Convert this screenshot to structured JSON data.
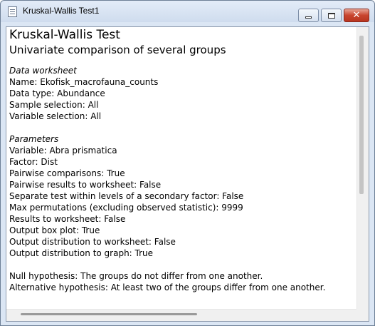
{
  "window": {
    "title": "Kruskal-Wallis Test1",
    "icon": "document-icon",
    "controls": {
      "minimize": "minimize-icon",
      "maximize": "maximize-icon",
      "close": "close-icon",
      "close_glyph": "✕"
    }
  },
  "report": {
    "title": "Kruskal-Wallis Test",
    "subtitle": "Univariate comparison of several groups",
    "data_section": {
      "heading": "Data worksheet",
      "lines": [
        "Name: Ekofisk_macrofauna_counts",
        "Data type: Abundance",
        "Sample selection: All",
        "Variable selection: All"
      ]
    },
    "parameters_section": {
      "heading": "Parameters",
      "lines": [
        "Variable: Abra prismatica",
        "Factor: Dist",
        "Pairwise comparisons: True",
        "Pairwise results to worksheet: False",
        "Separate test within levels of a secondary factor: False",
        "Max permutations (excluding observed statistic): 9999",
        "Results to worksheet: False",
        "Output box plot: True",
        "Output distribution to worksheet: False",
        "Output distribution to graph: True"
      ]
    },
    "hypotheses": [
      "Null hypothesis: The groups do not differ from one another.",
      "Alternative hypothesis: At least two of the groups differ from one another."
    ]
  },
  "colors": {
    "frame": "#dbe6f4",
    "close_button": "#c8452f",
    "text": "#000000"
  }
}
